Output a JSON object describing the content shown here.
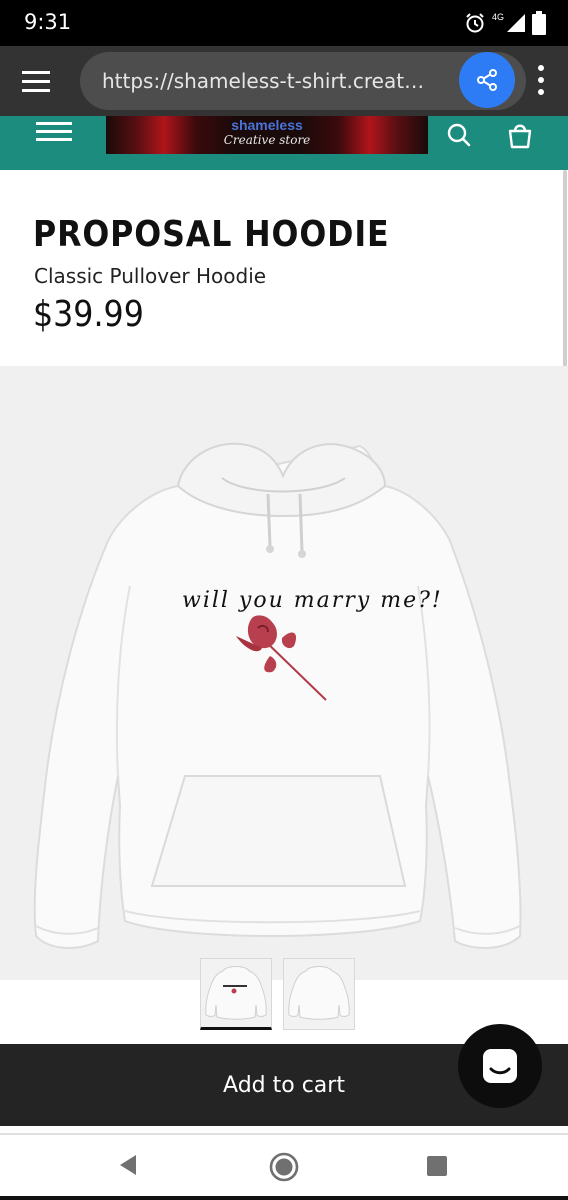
{
  "status_bar": {
    "time": "9:31",
    "network": "4G",
    "icons": [
      "alarm-icon",
      "signal-icon",
      "battery-icon"
    ]
  },
  "browser": {
    "url": "https://shameless-t-shirt.creator...",
    "menu_icon": "hamburger-icon",
    "share_icon": "share-icon",
    "more_icon": "more-vertical-icon",
    "share_color": "#2d7cf6"
  },
  "store_header": {
    "logo_top": "shameless",
    "logo_bottom": "Creative store",
    "menu_icon": "hamburger-icon",
    "search_icon": "search-icon",
    "bag_icon": "shopping-bag-icon",
    "color": "#1c8c7e"
  },
  "product": {
    "title": "PROPOSAL HOODIE",
    "subtitle": "Classic Pullover Hoodie",
    "price": "$39.99",
    "print_text": "will you marry me?!"
  },
  "thumbnails": {
    "items": [
      "front-view",
      "back-view"
    ],
    "selected": 0
  },
  "cart": {
    "label": "Add to cart",
    "chat_icon": "chat-icon"
  },
  "nav": {
    "back_icon": "back-icon",
    "home_icon": "home-icon",
    "recents_icon": "recents-icon"
  }
}
